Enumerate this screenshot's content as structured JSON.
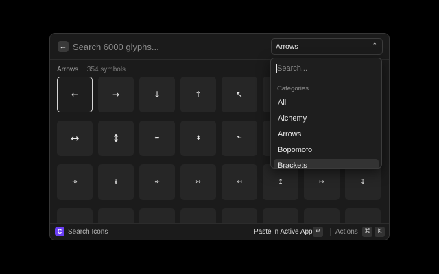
{
  "search": {
    "placeholder": "Search 6000 glyphs..."
  },
  "category_dropdown": {
    "value": "Arrows"
  },
  "section": {
    "title": "Arrows",
    "count": "354 symbols"
  },
  "glyphs": [
    [
      "←",
      "→",
      "↓",
      "↑",
      "↖",
      "",
      "",
      ""
    ],
    [
      "↔",
      "↕",
      "⬌",
      "⬍",
      "⬑",
      "",
      "",
      ""
    ],
    [
      "↠",
      "↡",
      "↞",
      "↣",
      "↤",
      "↥",
      "↦",
      "↧"
    ],
    [
      "",
      "",
      "",
      "",
      "",
      "",
      "",
      ""
    ]
  ],
  "popover": {
    "search_placeholder": "Search...",
    "section_label": "Categories",
    "items": [
      "All",
      "Alchemy",
      "Arrows",
      "Bopomofo",
      "Brackets"
    ]
  },
  "footer": {
    "title": "Search Icons",
    "primary_action": "Paste in Active App",
    "enter_key": "↵",
    "actions_label": "Actions",
    "cmd_key": "⌘",
    "k_key": "K"
  }
}
